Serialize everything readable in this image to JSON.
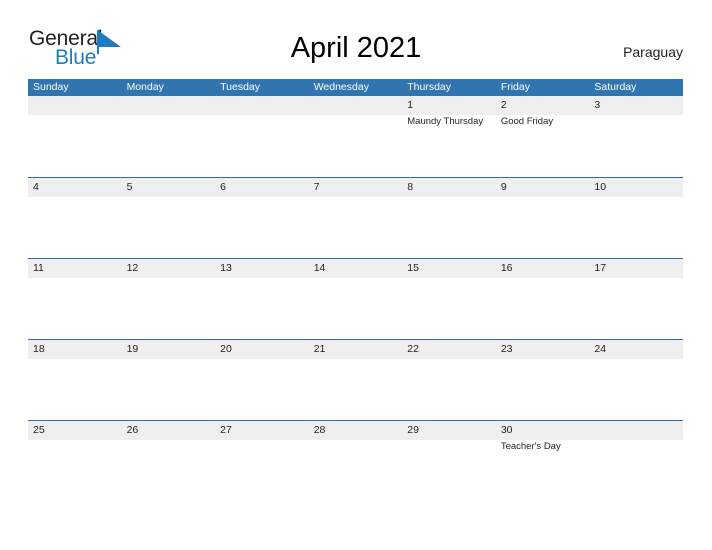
{
  "logo": {
    "text_primary": "General",
    "text_secondary": "Blue",
    "color_primary": "#231f20",
    "color_secondary": "#1d7cc1",
    "flag_icon": "blue-flag-triangle-icon"
  },
  "header": {
    "title": "April 2021",
    "country": "Paraguay"
  },
  "theme": {
    "header_blue": "#3175b0",
    "row_separator_blue": "#2e6da4",
    "band_gray": "#efefef",
    "text_color": "#231f20"
  },
  "calendar": {
    "weekdays": [
      "Sunday",
      "Monday",
      "Tuesday",
      "Wednesday",
      "Thursday",
      "Friday",
      "Saturday"
    ],
    "weeks": [
      [
        {
          "day": "",
          "event": ""
        },
        {
          "day": "",
          "event": ""
        },
        {
          "day": "",
          "event": ""
        },
        {
          "day": "",
          "event": ""
        },
        {
          "day": "1",
          "event": "Maundy Thursday"
        },
        {
          "day": "2",
          "event": "Good Friday"
        },
        {
          "day": "3",
          "event": ""
        }
      ],
      [
        {
          "day": "4",
          "event": ""
        },
        {
          "day": "5",
          "event": ""
        },
        {
          "day": "6",
          "event": ""
        },
        {
          "day": "7",
          "event": ""
        },
        {
          "day": "8",
          "event": ""
        },
        {
          "day": "9",
          "event": ""
        },
        {
          "day": "10",
          "event": ""
        }
      ],
      [
        {
          "day": "11",
          "event": ""
        },
        {
          "day": "12",
          "event": ""
        },
        {
          "day": "13",
          "event": ""
        },
        {
          "day": "14",
          "event": ""
        },
        {
          "day": "15",
          "event": ""
        },
        {
          "day": "16",
          "event": ""
        },
        {
          "day": "17",
          "event": ""
        }
      ],
      [
        {
          "day": "18",
          "event": ""
        },
        {
          "day": "19",
          "event": ""
        },
        {
          "day": "20",
          "event": ""
        },
        {
          "day": "21",
          "event": ""
        },
        {
          "day": "22",
          "event": ""
        },
        {
          "day": "23",
          "event": ""
        },
        {
          "day": "24",
          "event": ""
        }
      ],
      [
        {
          "day": "25",
          "event": ""
        },
        {
          "day": "26",
          "event": ""
        },
        {
          "day": "27",
          "event": ""
        },
        {
          "day": "28",
          "event": ""
        },
        {
          "day": "29",
          "event": ""
        },
        {
          "day": "30",
          "event": "Teacher's Day"
        },
        {
          "day": "",
          "event": ""
        }
      ]
    ]
  }
}
